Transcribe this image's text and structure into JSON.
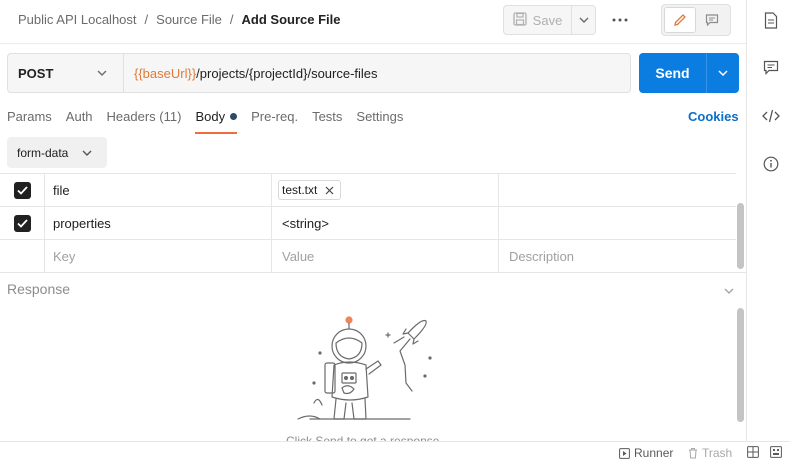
{
  "header": {
    "breadcrumb": [
      "Public API Localhost",
      "Source File",
      "Add Source File"
    ],
    "save_label": "Save",
    "more_label": "···"
  },
  "request": {
    "method": "POST",
    "url_variable": "{{baseUrl}}",
    "url_path": "/projects/{projectId}/source-files",
    "send_label": "Send"
  },
  "tabs": [
    {
      "label": "Params"
    },
    {
      "label": "Auth"
    },
    {
      "label": "Headers (11)"
    },
    {
      "label": "Body",
      "active": true
    },
    {
      "label": "Pre-req."
    },
    {
      "label": "Tests"
    },
    {
      "label": "Settings"
    }
  ],
  "cookies_label": "Cookies",
  "body_type": "form-data",
  "form": {
    "rows": [
      {
        "checked": true,
        "key": "file",
        "value": "test.txt",
        "value_type": "file"
      },
      {
        "checked": true,
        "key": "properties",
        "value": "<string>",
        "value_type": "text"
      }
    ],
    "placeholders": {
      "key": "Key",
      "value": "Value",
      "description": "Description"
    }
  },
  "response": {
    "title": "Response",
    "hint": "Click Send to get a response"
  },
  "statusbar": {
    "runner_label": "Runner",
    "trash_label": "Trash"
  },
  "colors": {
    "send": "#0c7de0",
    "variable": "#e07a3b",
    "tab_accent": "#f26b3a",
    "link": "#0c6fc9"
  }
}
